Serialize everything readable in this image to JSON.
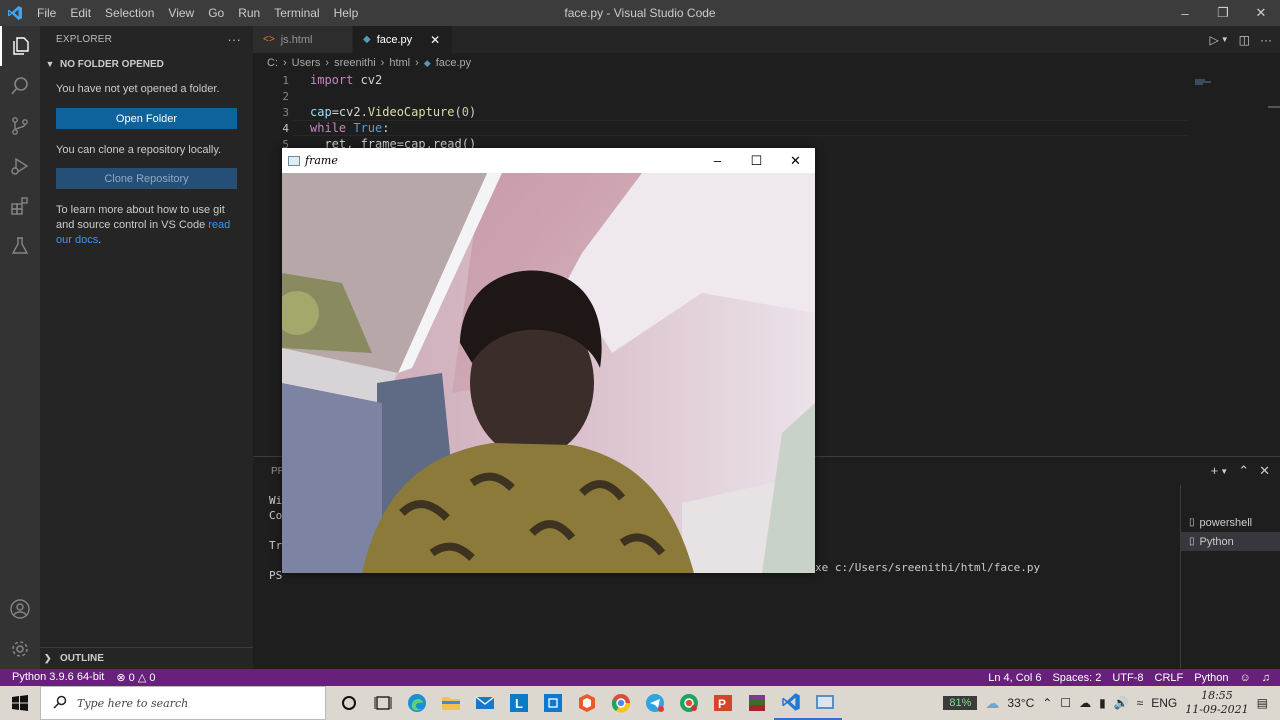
{
  "titlebar": {
    "title": "face.py - Visual Studio Code",
    "menu": [
      "File",
      "Edit",
      "Selection",
      "View",
      "Go",
      "Run",
      "Terminal",
      "Help"
    ]
  },
  "sidebar": {
    "header": "EXPLORER",
    "section": "NO FOLDER OPENED",
    "msg1": "You have not yet opened a folder.",
    "open_folder": "Open Folder",
    "msg2": "You can clone a repository locally.",
    "clone": "Clone Repository",
    "msg3": "To learn more about how to use git and source control in VS Code",
    "link": "read our docs",
    "msg3_end": ".",
    "outline": "OUTLINE"
  },
  "tabs": [
    {
      "label": "js.html",
      "icon": "html-icon"
    },
    {
      "label": "face.py",
      "icon": "python-icon"
    }
  ],
  "breadcrumb": [
    "C:",
    "Users",
    "sreenithi",
    "html",
    "face.py"
  ],
  "code": {
    "line_numbers": [
      "1",
      "2",
      "3",
      "4",
      "5"
    ],
    "l1_kw": "import",
    "l1_rest": " cv2",
    "l3_var": "cap",
    "l3_eq": "=cv2.",
    "l3_fn": "VideoCapture",
    "l3_open": "(",
    "l3_num": "0",
    "l3_close": ")",
    "l4_kw": "while",
    "l4_sp": " ",
    "l4_val": "True",
    "l4_colon": ":",
    "l5": "  ret, frame=cap.read()"
  },
  "panel": {
    "tab_prefix": "PR",
    "terminal_lines": [
      "Wi",
      "Co",
      "",
      "Tr",
      "",
      "PS"
    ],
    "terminal_tail": "xe c:/Users/sreenithi/html/face.py",
    "terminals": [
      "powershell",
      "Python"
    ]
  },
  "frame_window": {
    "title": "frame"
  },
  "status": {
    "interpreter": "Python 3.9.6 64-bit",
    "errors": "0",
    "warnings": "0",
    "position": "Ln 4, Col 6",
    "spaces": "Spaces: 2",
    "encoding": "UTF-8",
    "eol": "CRLF",
    "language": "Python"
  },
  "taskbar": {
    "search_placeholder": "Type here to search",
    "battery": "81%",
    "temperature": "33°C",
    "language": "ENG",
    "time": "18:55",
    "date": "11-09-2021"
  },
  "colors": {
    "status_bar": "#68217a",
    "button": "#0e639c",
    "link": "#3794ff"
  }
}
